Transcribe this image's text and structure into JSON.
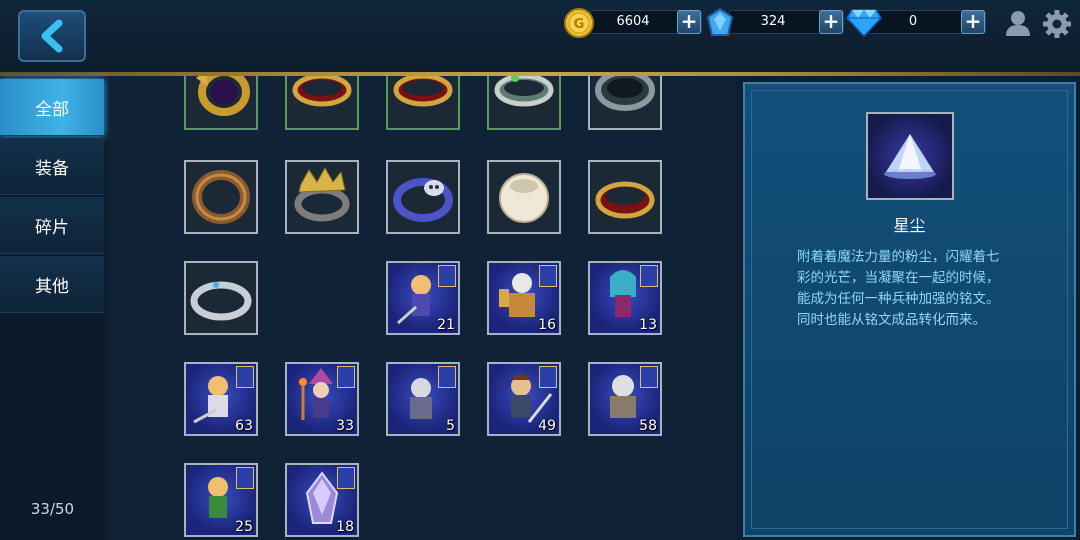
{
  "header": {
    "currencies": [
      {
        "name": "gold",
        "value": "6604",
        "icon": "gold-coin-icon",
        "color": "#f3c232"
      },
      {
        "name": "crystal",
        "value": "324",
        "icon": "blue-crystal-icon",
        "color": "#3fa6f0"
      },
      {
        "name": "diamond",
        "value": "0",
        "icon": "diamond-icon",
        "color": "#2aa4ff"
      }
    ],
    "icons": [
      "back-arrow-icon",
      "user-icon",
      "gear-icon"
    ]
  },
  "sidebar": {
    "tabs": [
      {
        "label": "全部",
        "active": true
      },
      {
        "label": "装备",
        "active": false
      },
      {
        "label": "碎片",
        "active": false
      },
      {
        "label": "其他",
        "active": false
      }
    ],
    "capacity": "33/50"
  },
  "inventory": {
    "rows": [
      [
        {
          "kind": "ring-dark-gem",
          "count": null,
          "frame": "green"
        },
        {
          "kind": "ring-gold-red",
          "count": null,
          "frame": "green"
        },
        {
          "kind": "ring-gold-red",
          "count": null,
          "frame": "green"
        },
        {
          "kind": "ring-silver-green",
          "count": null,
          "frame": "green"
        },
        {
          "kind": "ring-iron",
          "count": null,
          "frame": "grey"
        }
      ],
      [
        {
          "kind": "ring-bronze",
          "count": null,
          "frame": "grey"
        },
        {
          "kind": "ring-crowned",
          "count": null,
          "frame": "grey"
        },
        {
          "kind": "ring-skull",
          "count": null,
          "frame": "grey"
        },
        {
          "kind": "ring-ivory",
          "count": null,
          "frame": "grey"
        },
        {
          "kind": "ring-gold-red",
          "count": null,
          "frame": "grey"
        }
      ],
      [
        {
          "kind": "ring-silver",
          "count": null,
          "frame": "grey"
        },
        {
          "kind": "empty"
        },
        {
          "kind": "hero-fragment",
          "count": "21",
          "frame": "hero"
        },
        {
          "kind": "hero-fragment",
          "count": "16",
          "frame": "hero"
        },
        {
          "kind": "hero-fragment",
          "count": "13",
          "frame": "hero"
        }
      ],
      [
        {
          "kind": "hero-fragment",
          "count": "63",
          "frame": "hero"
        },
        {
          "kind": "hero-fragment",
          "count": "33",
          "frame": "hero"
        },
        {
          "kind": "hero-fragment",
          "count": "5",
          "frame": "hero"
        },
        {
          "kind": "hero-fragment",
          "count": "49",
          "frame": "hero"
        },
        {
          "kind": "hero-fragment",
          "count": "58",
          "frame": "hero"
        }
      ],
      [
        {
          "kind": "hero-fragment",
          "count": "25",
          "frame": "hero"
        },
        {
          "kind": "crystal-fragment",
          "count": "18",
          "frame": "hero"
        }
      ]
    ]
  },
  "detail": {
    "name": "星尘",
    "description_lines": [
      "附着着魔法力量的粉尘，闪耀着七",
      "彩的光芒，当凝聚在一起的时候，",
      "能成为任何一种兵种加强的铭文。",
      "同时也能从铭文成品转化而来。"
    ],
    "icon": "stardust-icon"
  }
}
